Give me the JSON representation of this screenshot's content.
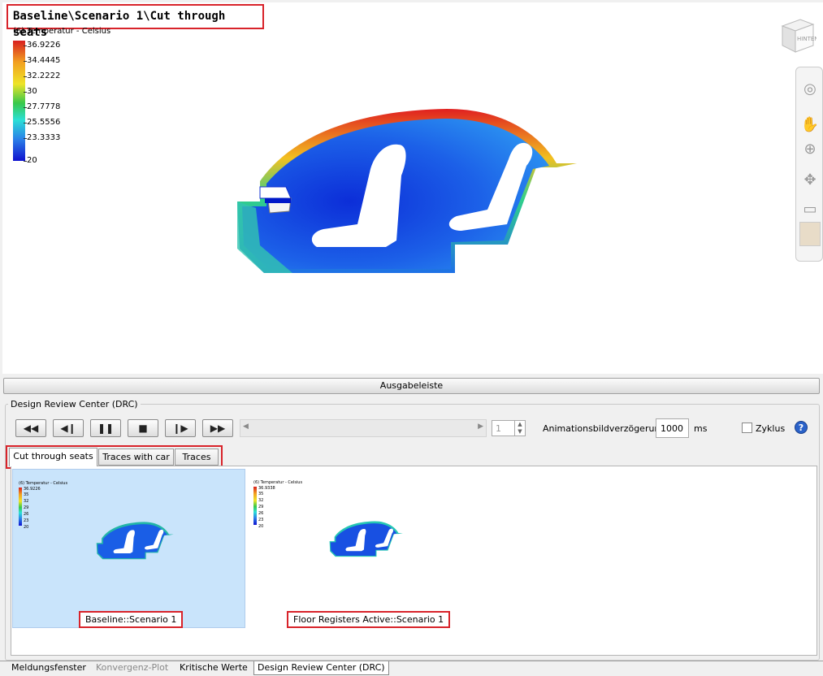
{
  "viewport": {
    "title": "Baseline\\Scenario 1\\Cut through seats",
    "legend": {
      "title": "(6) Temperatur - Celsius",
      "ticks": [
        "36.9226",
        "34.4445",
        "32.2222",
        "30",
        "27.7778",
        "25.5556",
        "23.3333",
        "20"
      ]
    },
    "navcube_label": "HINTEN",
    "nav_icons": [
      "steering-wheel-icon",
      "pan-hand-icon",
      "zoom-icon",
      "orbit-icon",
      "look-icon"
    ]
  },
  "output_bar": {
    "label": "Ausgabeleiste"
  },
  "drc": {
    "title": "Design Review Center (DRC)",
    "controls": {
      "rewind": "◀◀",
      "step_back": "◀❙",
      "pause": "❚❚",
      "stop": "■",
      "step_forward": "❙▶",
      "fast_forward": "▶▶"
    },
    "frame_value": "1",
    "delay_label": "Animationsbildverzögerung:",
    "delay_value": "1000",
    "delay_unit": "ms",
    "cycle_label": "Zyklus",
    "cycle_checked": false,
    "help": "?",
    "tabs": [
      {
        "label": "Cut through seats",
        "active": true
      },
      {
        "label": "Traces with car",
        "active": false
      },
      {
        "label": "Traces",
        "active": false
      }
    ],
    "thumbnails": [
      {
        "caption": "Baseline::Scenario 1",
        "selected": true,
        "legend_title": "(6) Temperatur - Celsius",
        "ticks": [
          "36.9226",
          "35",
          "32",
          "29",
          "26",
          "23",
          "20"
        ]
      },
      {
        "caption": "Floor Registers Active::Scenario 1",
        "selected": false,
        "legend_title": "(6) Temperatur - Celsius",
        "ticks": [
          "36.9338",
          "35",
          "32",
          "29",
          "26",
          "23",
          "20"
        ]
      }
    ]
  },
  "bottom_tabs": [
    {
      "label": "Meldungsfenster",
      "state": "normal"
    },
    {
      "label": "Konvergenz-Plot",
      "state": "disabled"
    },
    {
      "label": "Kritische Werte",
      "state": "normal"
    },
    {
      "label": "Design Review Center (DRC)",
      "state": "active"
    }
  ],
  "colors": {
    "highlight": "#d8232a",
    "selected_thumb": "#c9e4fb",
    "help": "#2a62c9"
  }
}
